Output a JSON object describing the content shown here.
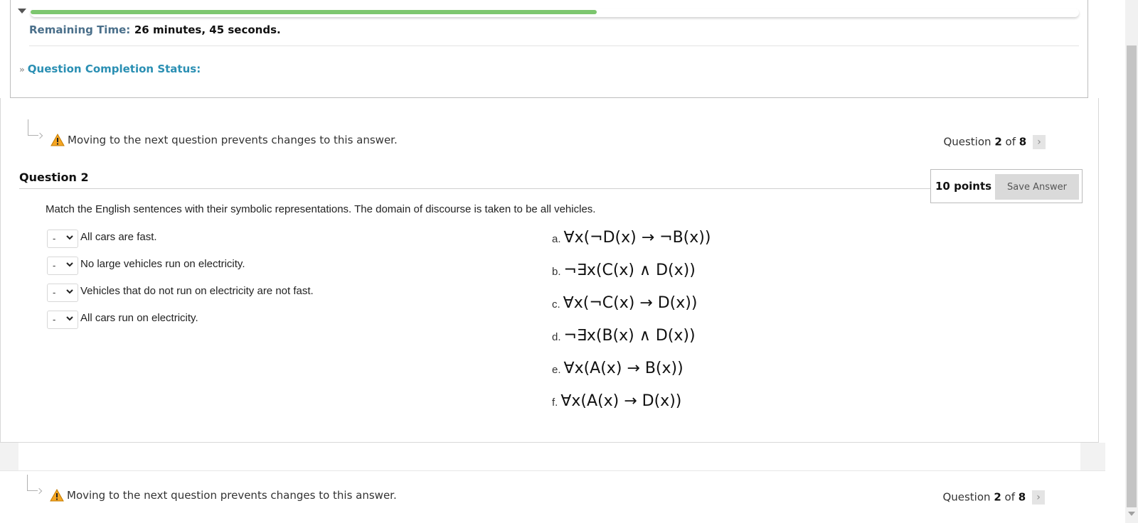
{
  "timer": {
    "progress_fraction": 0.54,
    "remaining_label": "Remaining Time:",
    "remaining_value": "26 minutes, 45 seconds."
  },
  "completion": {
    "icon": "double-chevron-down-icon",
    "label": "Question Completion Status:"
  },
  "warning": {
    "icon": "warning-icon",
    "text": "Moving to the next question prevents changes to this answer."
  },
  "navigation": {
    "prefix": "Question",
    "current": "2",
    "of": "of",
    "total": "8",
    "next_symbol": "›"
  },
  "question": {
    "title": "Question 2",
    "points": "10 points",
    "save_label": "Save Answer",
    "prompt": "Match the English sentences with their symbolic representations. The domain of discourse is taken to be all vehicles.",
    "items": [
      {
        "selected": "-",
        "text": "All cars are fast."
      },
      {
        "selected": "-",
        "text": "No large vehicles run on electricity."
      },
      {
        "selected": "-",
        "text": "Vehicles that do not run on electricity are not fast."
      },
      {
        "selected": "-",
        "text": "All cars run on electricity."
      }
    ],
    "options": [
      {
        "letter": "a.",
        "formula": "∀x(¬D(x) → ¬B(x))"
      },
      {
        "letter": "b.",
        "formula": "¬∃x(C(x) ∧ D(x))"
      },
      {
        "letter": "c.",
        "formula": "∀x(¬C(x) → D(x))"
      },
      {
        "letter": "d.",
        "formula": "¬∃x(B(x) ∧ D(x))"
      },
      {
        "letter": "e.",
        "formula": "∀x(A(x) → B(x))"
      },
      {
        "letter": "f.",
        "formula": "∀x(A(x) → D(x))"
      }
    ]
  },
  "colors": {
    "progress": "#7cc66e",
    "time_label": "#4a6f8a",
    "completion_link": "#2a8fb3",
    "warning_fill": "#f5a623"
  }
}
